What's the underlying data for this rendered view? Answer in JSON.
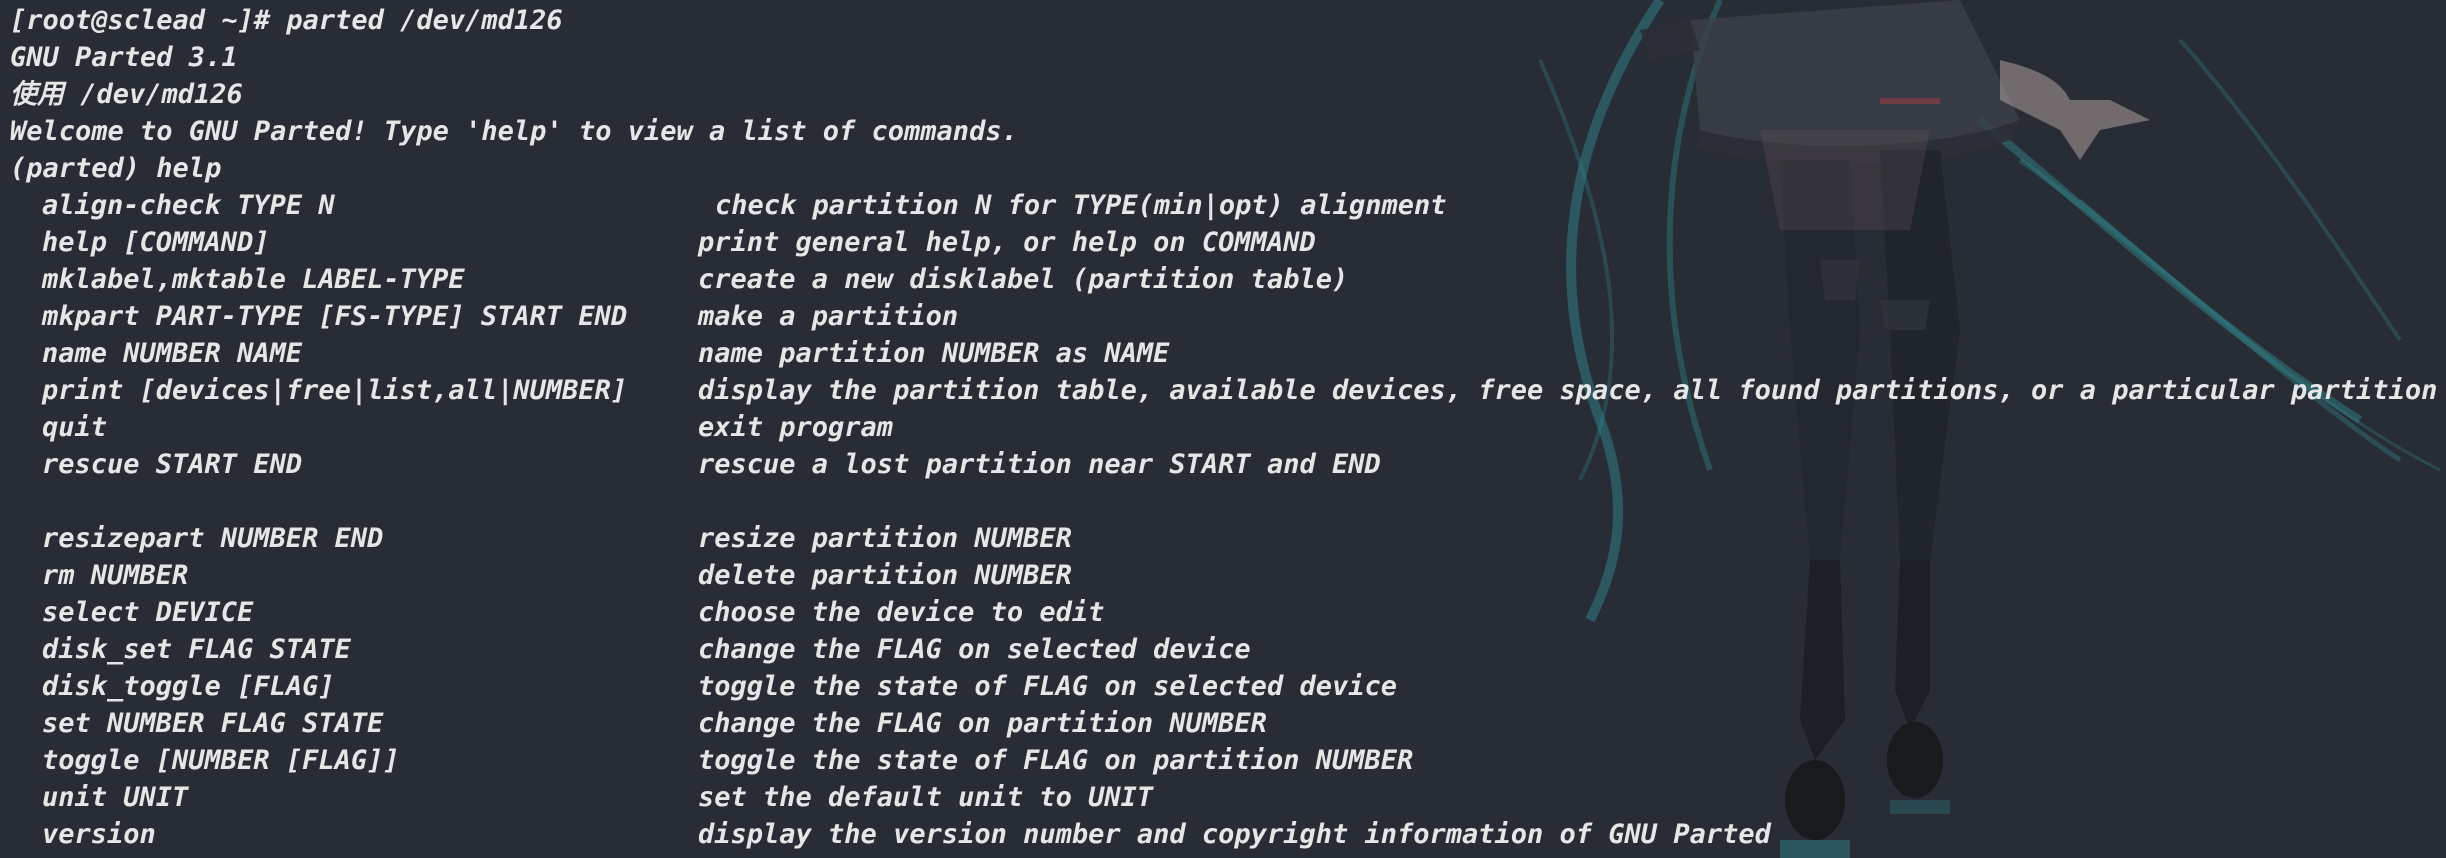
{
  "terminal": {
    "header_lines": [
      "[root@sclead ~]# parted /dev/md126",
      "GNU Parted 3.1",
      "使用 /dev/md126",
      "Welcome to GNU Parted! Type 'help' to view a list of commands.",
      "(parted) help"
    ],
    "commands": [
      {
        "cmd": "align-check TYPE N",
        "desc": "check partition N for TYPE(min|opt) alignment"
      },
      {
        "cmd": "help [COMMAND]",
        "desc": "print general help, or help on COMMAND"
      },
      {
        "cmd": "mklabel,mktable LABEL-TYPE",
        "desc": "create a new disklabel (partition table)"
      },
      {
        "cmd": "mkpart PART-TYPE [FS-TYPE] START END",
        "desc": "make a partition"
      },
      {
        "cmd": "name NUMBER NAME",
        "desc": "name partition NUMBER as NAME"
      },
      {
        "cmd": "print [devices|free|list,all|NUMBER]",
        "desc": "display the partition table, available devices, free space, all found partitions, or a particular partition"
      },
      {
        "cmd": "quit",
        "desc": "exit program"
      },
      {
        "cmd": "rescue START END",
        "desc": "rescue a lost partition near START and END"
      }
    ],
    "commands_after_blank": [
      {
        "cmd": "resizepart NUMBER END",
        "desc": "resize partition NUMBER"
      },
      {
        "cmd": "rm NUMBER",
        "desc": "delete partition NUMBER"
      },
      {
        "cmd": "select DEVICE",
        "desc": "choose the device to edit"
      },
      {
        "cmd": "disk_set FLAG STATE",
        "desc": "change the FLAG on selected device"
      },
      {
        "cmd": "disk_toggle [FLAG]",
        "desc": "toggle the state of FLAG on selected device"
      },
      {
        "cmd": "set NUMBER FLAG STATE",
        "desc": "change the FLAG on partition NUMBER"
      },
      {
        "cmd": "toggle [NUMBER [FLAG]]",
        "desc": "toggle the state of FLAG on partition NUMBER"
      },
      {
        "cmd": "unit UNIT",
        "desc": "set the default unit to UNIT"
      },
      {
        "cmd": "version",
        "desc": "display the version number and copyright information of GNU Parted"
      }
    ],
    "colors": {
      "background": "#282c34",
      "text": "#e6e6e6",
      "art_teal": "#2f7f86",
      "art_dark": "#1c1f25"
    }
  }
}
